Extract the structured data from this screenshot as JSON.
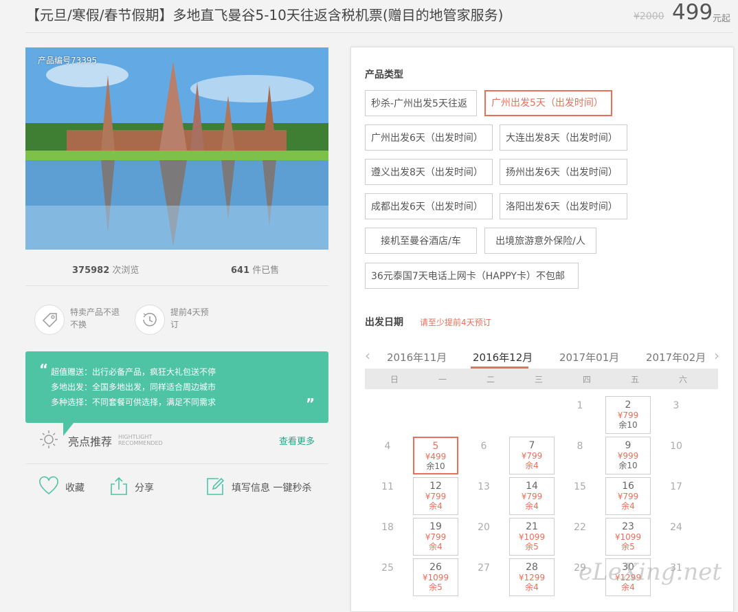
{
  "header": {
    "title": "【元旦/寒假/春节假期】多地直飞曼谷5-10天往返含税机票(赠目的地管家服务)",
    "old_price": "¥2000",
    "price": "499",
    "price_unit": "元起"
  },
  "product": {
    "photo_code": "产品编号73395",
    "views_num": "375982",
    "views_label": "次浏览",
    "sold_num": "641",
    "sold_label": "件已售",
    "features": [
      {
        "icon": "tag-icon",
        "text": "特卖产品不退不换"
      },
      {
        "icon": "clock-icon",
        "text": "提前4天预订"
      }
    ]
  },
  "highlights": {
    "lines": [
      "超值赠送：出行必备产品，疯狂大礼包送不停",
      "多地出发：全国多地出发，同样适合周边城市",
      "多种选择：不同套餐可供选择，满足不同需求"
    ],
    "title": "亮点推荐",
    "title_en_1": "HIGHTLIGHT",
    "title_en_2": "RECOMMENDED",
    "more": "查看更多"
  },
  "actions": {
    "favorite": "收藏",
    "share": "分享",
    "fill": "填写信息 一键秒杀"
  },
  "product_type": {
    "label": "产品类型",
    "options": [
      "秒杀-广州出发5天往返",
      "广州出发5天（出发时间）",
      "广州出发6天（出发时间）",
      "大连出发8天（出发时间）",
      "遵义出发8天（出发时间）",
      "扬州出发6天（出发时间）",
      "成都出发6天（出发时间）",
      "洛阳出发6天（出发时间）",
      "接机至曼谷酒店/车",
      "出境旅游意外保险/人",
      "36元泰国7天电话上网卡（HAPPY卡）不包邮"
    ],
    "selected_index": 1
  },
  "departure": {
    "label": "出发日期",
    "notice": "请至少提前4天预订",
    "months": [
      "2016年11月",
      "2016年12月",
      "2017年01月",
      "2017年02月"
    ],
    "active_month": "2016年12月",
    "prev_arrow": "‹",
    "next_arrow": "›",
    "weekdays": [
      "日",
      "一",
      "二",
      "三",
      "四",
      "五",
      "六"
    ],
    "days": [
      {
        "d": "1"
      },
      {
        "d": "2",
        "p": "¥799",
        "r": "余10"
      },
      {
        "d": "3"
      },
      {
        "d": "4"
      },
      {
        "d": "5",
        "p": "¥499",
        "r": "余10",
        "sel": true
      },
      {
        "d": "6"
      },
      {
        "d": "7",
        "p": "¥799",
        "r": "余4"
      },
      {
        "d": "8"
      },
      {
        "d": "9",
        "p": "¥999",
        "r": "余10"
      },
      {
        "d": "10"
      },
      {
        "d": "11"
      },
      {
        "d": "12",
        "p": "¥799",
        "r": "余4"
      },
      {
        "d": "13"
      },
      {
        "d": "14",
        "p": "¥799",
        "r": "余4"
      },
      {
        "d": "15"
      },
      {
        "d": "16",
        "p": "¥799",
        "r": "余4"
      },
      {
        "d": "17"
      },
      {
        "d": "18"
      },
      {
        "d": "19",
        "p": "¥799",
        "r": "余4"
      },
      {
        "d": "20"
      },
      {
        "d": "21",
        "p": "¥1099",
        "r": "余5"
      },
      {
        "d": "22"
      },
      {
        "d": "23",
        "p": "¥1099",
        "r": "余5"
      },
      {
        "d": "24"
      },
      {
        "d": "25"
      },
      {
        "d": "26",
        "p": "¥1099",
        "r": "余5"
      },
      {
        "d": "27"
      },
      {
        "d": "28",
        "p": "¥1299",
        "r": "余4"
      },
      {
        "d": "29"
      },
      {
        "d": "30",
        "p": "¥1299",
        "r": "余4"
      },
      {
        "d": "31"
      }
    ]
  },
  "watermark": "eLeXing.net",
  "colors": {
    "accent": "#e86f5b",
    "green": "#4ec4a4",
    "link": "#2aa485"
  }
}
